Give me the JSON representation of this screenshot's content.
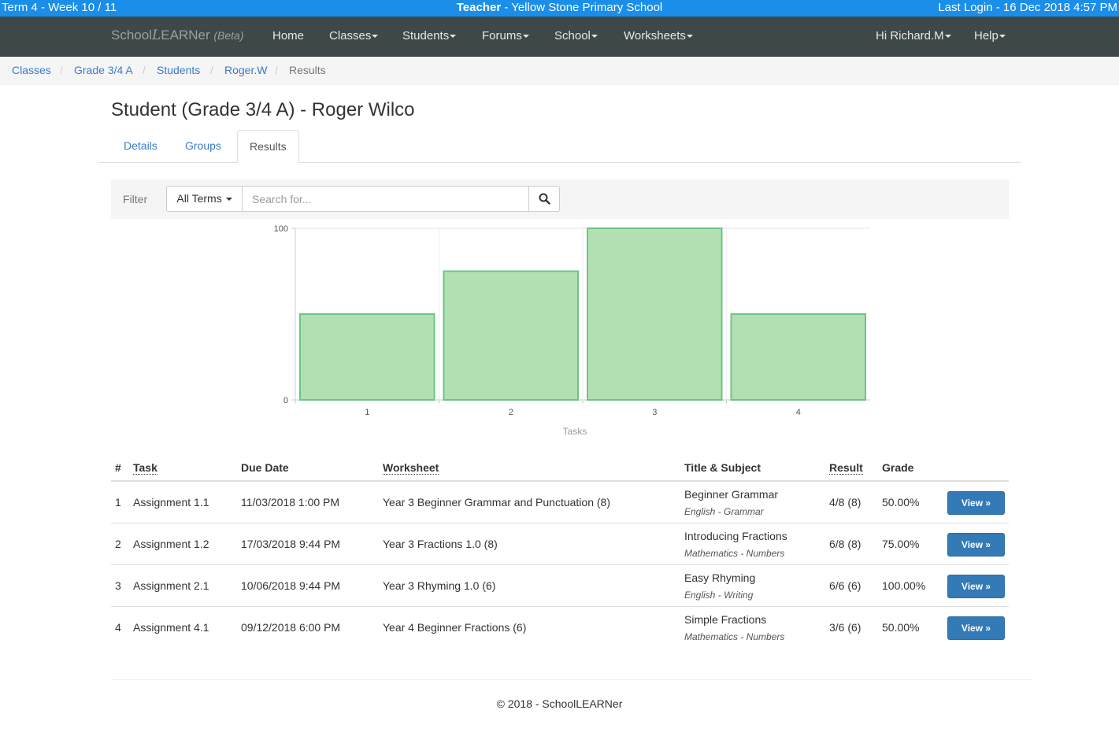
{
  "status_bar": {
    "term": "Term 4 - Week 10 / 11",
    "role": "Teacher",
    "school": " - Yellow Stone Primary School",
    "last_login": "Last Login - 16 Dec 2018 4:57 PM"
  },
  "navbar": {
    "brand_school": "School",
    "brand_l": "L",
    "brand_earner": "EARNer",
    "brand_beta": "(Beta)",
    "items": [
      "Home",
      "Classes",
      "Students",
      "Forums",
      "School",
      "Worksheets"
    ],
    "user": "Hi Richard.M",
    "help": "Help"
  },
  "breadcrumb": [
    "Classes",
    "Grade 3/4 A",
    "Students",
    "Roger.W",
    "Results"
  ],
  "page_title": "Student (Grade 3/4 A) - Roger Wilco",
  "tabs": [
    "Details",
    "Groups",
    "Results"
  ],
  "active_tab": "Results",
  "filter": {
    "label": "Filter",
    "terms_label": "All Terms",
    "search_placeholder": "Search for...",
    "search_icon": "magnifier-icon"
  },
  "chart_data": {
    "type": "bar",
    "categories": [
      "1",
      "2",
      "3",
      "4"
    ],
    "values": [
      50,
      75,
      100,
      50
    ],
    "xlabel": "Tasks",
    "ylabel": "",
    "ylim": [
      0,
      100
    ],
    "yticks": [
      "0",
      "100"
    ],
    "bar_fill": "#b3e0b3",
    "bar_stroke": "#6cc486",
    "grid": true
  },
  "table": {
    "headers": [
      "#",
      "Task",
      "Due Date",
      "Worksheet",
      "Title & Subject",
      "Result",
      "Grade"
    ],
    "rows": [
      {
        "num": "1",
        "task": "Assignment 1.1",
        "due": "11/03/2018 1:00 PM",
        "worksheet": "Year 3 Beginner Grammar and Punctuation (8)",
        "title": "Beginner Grammar",
        "subject": "English - Grammar",
        "result": "4/8 (8)",
        "grade": "50.00%",
        "action": "View »"
      },
      {
        "num": "2",
        "task": "Assignment 1.2",
        "due": "17/03/2018 9:44 PM",
        "worksheet": "Year 3 Fractions 1.0 (8)",
        "title": "Introducing Fractions",
        "subject": "Mathematics - Numbers",
        "result": "6/8 (8)",
        "grade": "75.00%",
        "action": "View »"
      },
      {
        "num": "3",
        "task": "Assignment 2.1",
        "due": "10/06/2018 9:44 PM",
        "worksheet": "Year 3 Rhyming 1.0 (6)",
        "title": "Easy Rhyming",
        "subject": "English - Writing",
        "result": "6/6 (6)",
        "grade": "100.00%",
        "action": "View »"
      },
      {
        "num": "4",
        "task": "Assignment 4.1",
        "due": "09/12/2018 6:00 PM",
        "worksheet": "Year 4 Beginner Fractions (6)",
        "title": "Simple Fractions",
        "subject": "Mathematics - Numbers",
        "result": "3/6 (6)",
        "grade": "50.00%",
        "action": "View »"
      }
    ]
  },
  "footer": "© 2018 - SchoolLEARNer"
}
